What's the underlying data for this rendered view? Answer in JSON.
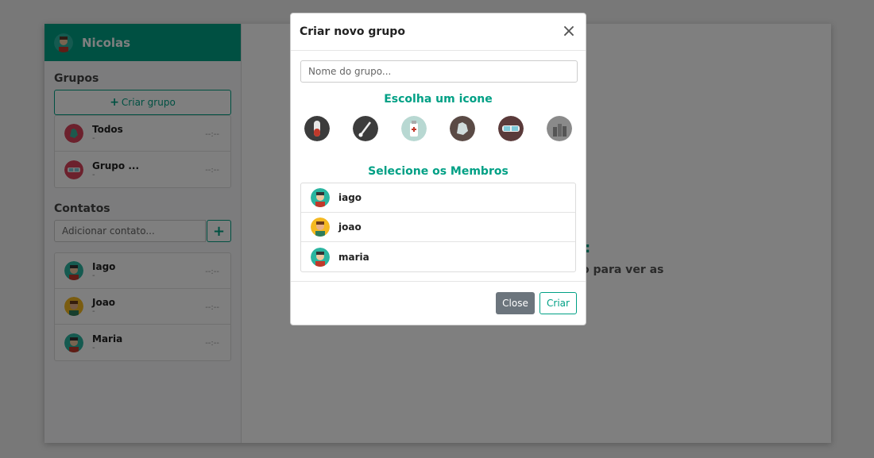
{
  "user": {
    "name": "Nicolas"
  },
  "groups": {
    "title": "Grupos",
    "create_label": "Criar grupo",
    "items": [
      {
        "name": "Todos",
        "sub": "-",
        "time": "--:--",
        "icon": "gloves-icon"
      },
      {
        "name": "Grupo ...",
        "sub": "-",
        "time": "--:--",
        "icon": "goggles-icon"
      }
    ]
  },
  "contacts": {
    "title": "Contatos",
    "add_placeholder": "Adicionar contato...",
    "add_label": "+",
    "items": [
      {
        "name": "Iago",
        "sub": "-",
        "time": "--:--"
      },
      {
        "name": "Joao",
        "sub": "-",
        "time": "--:--"
      },
      {
        "name": "Maria",
        "sub": "-",
        "time": "--:--"
      }
    ]
  },
  "main": {
    "text_partial": ":",
    "hint_partial": "o para ver as"
  },
  "modal": {
    "title": "Criar novo grupo",
    "close_symbol": "×",
    "name_placeholder": "Nome do grupo...",
    "icon_heading": "Escolha um icone",
    "icons": [
      "test-tube-icon",
      "swab-icon",
      "vaccine-vial-icon",
      "gloves-icon",
      "goggles-icon",
      "city-icon"
    ],
    "members_heading": "Selecione os Membros",
    "members": [
      {
        "name": "iago"
      },
      {
        "name": "joao"
      },
      {
        "name": "maria"
      }
    ],
    "close_label": "Close",
    "create_label": "Criar"
  },
  "colors": {
    "accent": "#00a085",
    "backdrop": "rgba(0,0,0,0.5)",
    "secondary": "#6c757d"
  }
}
